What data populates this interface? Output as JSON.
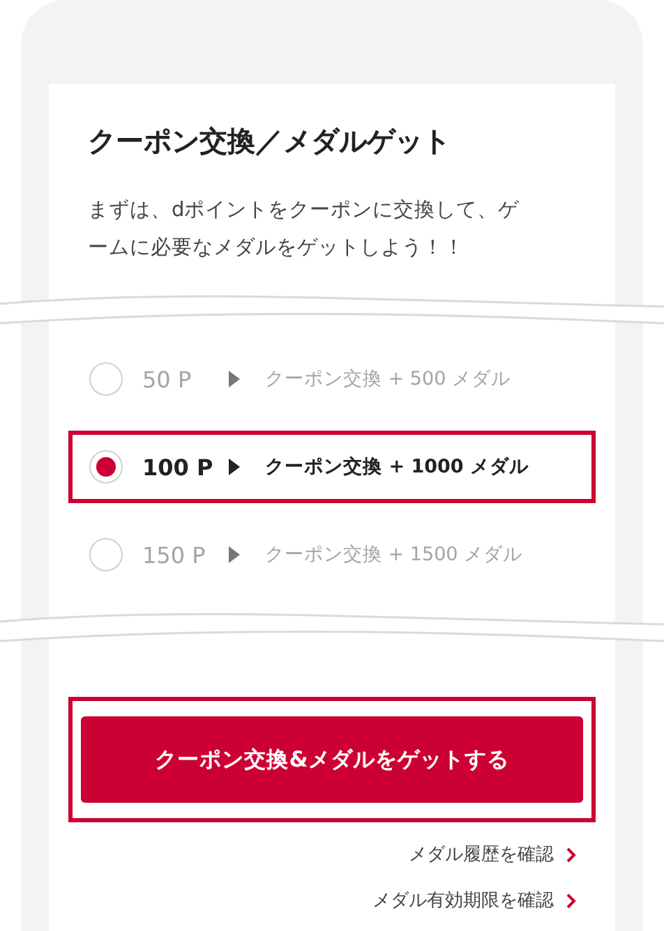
{
  "panel": {
    "title": "クーポン交換／メダルゲット",
    "description": "まずは、dポイントをクーポンに交換して、ゲームに必要なメダルをゲットしよう！！"
  },
  "options": [
    {
      "points": "50 P",
      "reward": "クーポン交換 + 500 メダル",
      "selected": false
    },
    {
      "points": "100 P",
      "reward": "クーポン交換 + 1000 メダル",
      "selected": true
    },
    {
      "points": "150 P",
      "reward": "クーポン交換 + 1500 メダル",
      "selected": false
    }
  ],
  "action_button": {
    "label": "クーポン交換&メダルをゲットする",
    "highlighted": true
  },
  "links": [
    {
      "label": "メダル履歴を確認"
    },
    {
      "label": "メダル有効期限を確認"
    }
  ]
}
